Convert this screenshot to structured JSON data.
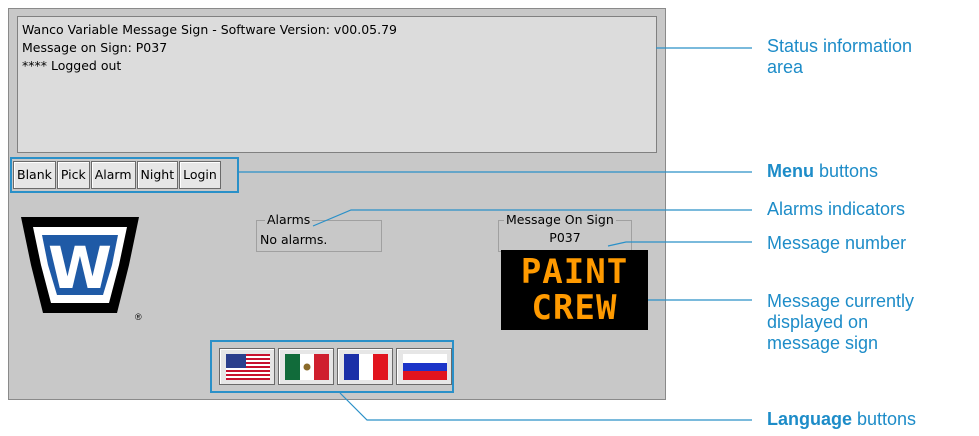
{
  "status": {
    "lines": [
      "Wanco Variable Message Sign - Software Version: v00.05.79",
      "Message on Sign: P037",
      "**** Logged out"
    ]
  },
  "menu": {
    "buttons": [
      "Blank",
      "Pick",
      "Alarm",
      "Night",
      "Login"
    ]
  },
  "alarms": {
    "label": "Alarms",
    "value": "No alarms."
  },
  "message_on_sign": {
    "label": "Message On Sign",
    "number": "P037",
    "display_lines": [
      "PAINT",
      "CREW"
    ]
  },
  "logo": {
    "letter": "W",
    "registered": "®"
  },
  "languages": [
    "english-flag-icon",
    "spanish-flag-icon",
    "french-flag-icon",
    "russian-flag-icon"
  ],
  "annotations": {
    "status_area": [
      "Status information",
      "area"
    ],
    "menu_bold": "Menu",
    "menu_rest": " buttons",
    "alarms": "Alarms indicators",
    "message_number": "Message number",
    "message_display": [
      "Message currently",
      "displayed on",
      "message sign"
    ],
    "language_bold": "Language",
    "language_rest": " buttons"
  },
  "colors": {
    "accent": "#1d8cc8",
    "sign_text": "#ff9a00",
    "logo_blue": "#1f5aa6"
  }
}
